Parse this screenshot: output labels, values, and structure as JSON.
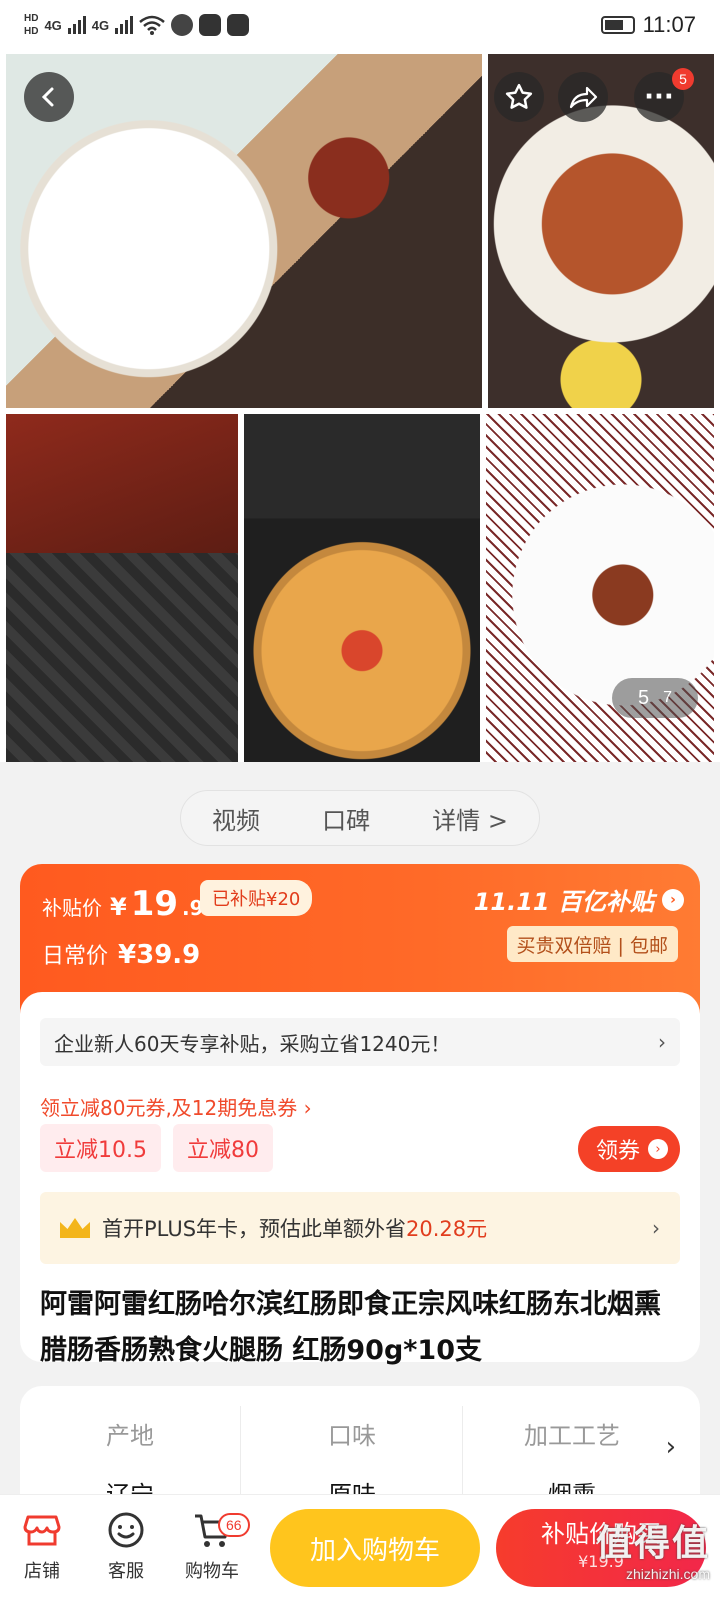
{
  "status": {
    "network": [
      "HD",
      "HD"
    ],
    "sim_labels": [
      "4G",
      "4G"
    ],
    "time": "11:07"
  },
  "gallery": {
    "more_badge": "5",
    "counter_current": "5",
    "counter_total": "7"
  },
  "tabs": [
    "视频",
    "口碑",
    "详情 >"
  ],
  "price": {
    "subsidy_label": "补贴价",
    "currency": "¥",
    "integer": "19",
    "decimal": ".9",
    "subsidy_tag": "已补贴¥20",
    "regular_label": "日常价",
    "regular_value": "¥39.9",
    "brand": "11.11 百亿补贴",
    "guarantee": "买贵双倍赔 | 包邮"
  },
  "promo": {
    "enterprise_text": "企业新人60天专享补贴，采购立省1240元！",
    "enterprise_arrow": "›",
    "coupon_line": "领立减80元券,及12期免息券 ›",
    "chips": [
      "立减10.5",
      "立减80"
    ],
    "coupon_button": "领券",
    "plus_prefix": "首开PLUS年卡，预估此单额外省",
    "plus_amount": "20.28元",
    "plus_arrow": "›"
  },
  "product": {
    "title": "阿雷阿雷红肠哈尔滨红肠即食正宗风味红肠东北烟熏腊肠香肠熟食火腿肠 红肠90g*10支"
  },
  "specs": [
    {
      "key": "产地",
      "value": "辽宁"
    },
    {
      "key": "口味",
      "value": "原味"
    },
    {
      "key": "加工工艺",
      "value": "烟熏"
    }
  ],
  "spec_arrow": "›",
  "bottom_nav": {
    "store": "店铺",
    "service": "客服",
    "cart": "购物车",
    "cart_badge": "66",
    "add_to_cart": "加入购物车",
    "buy_label": "补贴价购买",
    "buy_price": "¥19.9"
  },
  "watermark": {
    "main": "值得值",
    "sub": "zhizhizhi.com"
  },
  "colors": {
    "accent_orange": "#ff5a1f",
    "red": "#f03b2f",
    "yellow_button": "#ffc51d"
  }
}
